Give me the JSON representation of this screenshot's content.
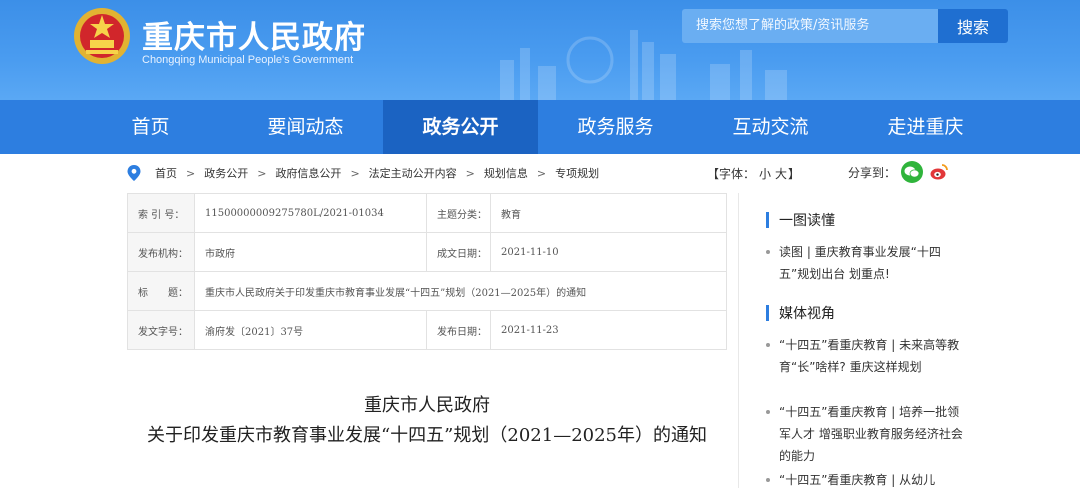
{
  "header": {
    "site_title": "重庆市人民政府",
    "site_subtitle": "Chongqing Municipal People's Government",
    "search_placeholder": "搜索您想了解的政策/资讯服务",
    "search_button": "搜索"
  },
  "nav": {
    "items": [
      "首页",
      "要闻动态",
      "政务公开",
      "政务服务",
      "互动交流",
      "走进重庆"
    ],
    "active_index": 2
  },
  "breadcrumb": [
    "首页",
    "政务公开",
    "政府信息公开",
    "法定主动公开内容",
    "规划信息",
    "专项规划"
  ],
  "breadcrumb_separator": ">",
  "font_size": {
    "label": "【字体：",
    "small": "小",
    "large": "大",
    "close": "】"
  },
  "share": {
    "label": "分享到：",
    "wechat_color": "#2fb43b",
    "weibo_color": "#e2383a"
  },
  "meta": {
    "index_key": "索 引 号：",
    "index_value": "11500000009275780L/2021-01034",
    "topic_key": "主题分类：",
    "topic_value": "教育",
    "publisher_key": "发布机构：",
    "publisher_value": "市政府",
    "created_key": "成文日期：",
    "created_value": "2021-11-10",
    "title_key": "标　　题：",
    "title_value": "重庆市人民政府关于印发重庆市教育事业发展“十四五”规划（2021—2025年）的通知",
    "docno_key": "发文字号：",
    "docno_value": "渝府发〔2021〕37号",
    "pubdate_key": "发布日期：",
    "pubdate_value": "2021-11-23"
  },
  "doc_title": {
    "line1": "重庆市人民政府",
    "line2": "关于印发重庆市教育事业发展“十四五”规划（2021—2025年）的通知"
  },
  "sidebar": {
    "section1_title": "一图读懂",
    "section1_items": [
      "读图 | 重庆教育事业发展“十四五”规划出台 划重点!"
    ],
    "section2_title": "媒体视角",
    "section2_items": [
      "“十四五”看重庆教育 | 未来高等教育“长”啥样? 重庆这样规划",
      "“十四五”看重庆教育 | 培养一批领军人才 增强职业教育服务经济社会的能力",
      "“十四五”看重庆教育 | 从幼儿"
    ]
  }
}
